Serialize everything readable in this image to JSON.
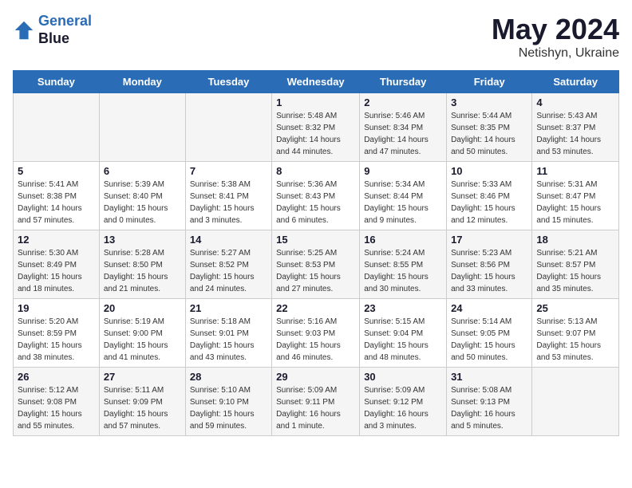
{
  "header": {
    "logo_line1": "General",
    "logo_line2": "Blue",
    "main_title": "May 2024",
    "subtitle": "Netishyn, Ukraine"
  },
  "days_of_week": [
    "Sunday",
    "Monday",
    "Tuesday",
    "Wednesday",
    "Thursday",
    "Friday",
    "Saturday"
  ],
  "weeks": [
    [
      {
        "day": "",
        "info": ""
      },
      {
        "day": "",
        "info": ""
      },
      {
        "day": "",
        "info": ""
      },
      {
        "day": "1",
        "info": "Sunrise: 5:48 AM\nSunset: 8:32 PM\nDaylight: 14 hours\nand 44 minutes."
      },
      {
        "day": "2",
        "info": "Sunrise: 5:46 AM\nSunset: 8:34 PM\nDaylight: 14 hours\nand 47 minutes."
      },
      {
        "day": "3",
        "info": "Sunrise: 5:44 AM\nSunset: 8:35 PM\nDaylight: 14 hours\nand 50 minutes."
      },
      {
        "day": "4",
        "info": "Sunrise: 5:43 AM\nSunset: 8:37 PM\nDaylight: 14 hours\nand 53 minutes."
      }
    ],
    [
      {
        "day": "5",
        "info": "Sunrise: 5:41 AM\nSunset: 8:38 PM\nDaylight: 14 hours\nand 57 minutes."
      },
      {
        "day": "6",
        "info": "Sunrise: 5:39 AM\nSunset: 8:40 PM\nDaylight: 15 hours\nand 0 minutes."
      },
      {
        "day": "7",
        "info": "Sunrise: 5:38 AM\nSunset: 8:41 PM\nDaylight: 15 hours\nand 3 minutes."
      },
      {
        "day": "8",
        "info": "Sunrise: 5:36 AM\nSunset: 8:43 PM\nDaylight: 15 hours\nand 6 minutes."
      },
      {
        "day": "9",
        "info": "Sunrise: 5:34 AM\nSunset: 8:44 PM\nDaylight: 15 hours\nand 9 minutes."
      },
      {
        "day": "10",
        "info": "Sunrise: 5:33 AM\nSunset: 8:46 PM\nDaylight: 15 hours\nand 12 minutes."
      },
      {
        "day": "11",
        "info": "Sunrise: 5:31 AM\nSunset: 8:47 PM\nDaylight: 15 hours\nand 15 minutes."
      }
    ],
    [
      {
        "day": "12",
        "info": "Sunrise: 5:30 AM\nSunset: 8:49 PM\nDaylight: 15 hours\nand 18 minutes."
      },
      {
        "day": "13",
        "info": "Sunrise: 5:28 AM\nSunset: 8:50 PM\nDaylight: 15 hours\nand 21 minutes."
      },
      {
        "day": "14",
        "info": "Sunrise: 5:27 AM\nSunset: 8:52 PM\nDaylight: 15 hours\nand 24 minutes."
      },
      {
        "day": "15",
        "info": "Sunrise: 5:25 AM\nSunset: 8:53 PM\nDaylight: 15 hours\nand 27 minutes."
      },
      {
        "day": "16",
        "info": "Sunrise: 5:24 AM\nSunset: 8:55 PM\nDaylight: 15 hours\nand 30 minutes."
      },
      {
        "day": "17",
        "info": "Sunrise: 5:23 AM\nSunset: 8:56 PM\nDaylight: 15 hours\nand 33 minutes."
      },
      {
        "day": "18",
        "info": "Sunrise: 5:21 AM\nSunset: 8:57 PM\nDaylight: 15 hours\nand 35 minutes."
      }
    ],
    [
      {
        "day": "19",
        "info": "Sunrise: 5:20 AM\nSunset: 8:59 PM\nDaylight: 15 hours\nand 38 minutes."
      },
      {
        "day": "20",
        "info": "Sunrise: 5:19 AM\nSunset: 9:00 PM\nDaylight: 15 hours\nand 41 minutes."
      },
      {
        "day": "21",
        "info": "Sunrise: 5:18 AM\nSunset: 9:01 PM\nDaylight: 15 hours\nand 43 minutes."
      },
      {
        "day": "22",
        "info": "Sunrise: 5:16 AM\nSunset: 9:03 PM\nDaylight: 15 hours\nand 46 minutes."
      },
      {
        "day": "23",
        "info": "Sunrise: 5:15 AM\nSunset: 9:04 PM\nDaylight: 15 hours\nand 48 minutes."
      },
      {
        "day": "24",
        "info": "Sunrise: 5:14 AM\nSunset: 9:05 PM\nDaylight: 15 hours\nand 50 minutes."
      },
      {
        "day": "25",
        "info": "Sunrise: 5:13 AM\nSunset: 9:07 PM\nDaylight: 15 hours\nand 53 minutes."
      }
    ],
    [
      {
        "day": "26",
        "info": "Sunrise: 5:12 AM\nSunset: 9:08 PM\nDaylight: 15 hours\nand 55 minutes."
      },
      {
        "day": "27",
        "info": "Sunrise: 5:11 AM\nSunset: 9:09 PM\nDaylight: 15 hours\nand 57 minutes."
      },
      {
        "day": "28",
        "info": "Sunrise: 5:10 AM\nSunset: 9:10 PM\nDaylight: 15 hours\nand 59 minutes."
      },
      {
        "day": "29",
        "info": "Sunrise: 5:09 AM\nSunset: 9:11 PM\nDaylight: 16 hours\nand 1 minute."
      },
      {
        "day": "30",
        "info": "Sunrise: 5:09 AM\nSunset: 9:12 PM\nDaylight: 16 hours\nand 3 minutes."
      },
      {
        "day": "31",
        "info": "Sunrise: 5:08 AM\nSunset: 9:13 PM\nDaylight: 16 hours\nand 5 minutes."
      },
      {
        "day": "",
        "info": ""
      }
    ]
  ]
}
